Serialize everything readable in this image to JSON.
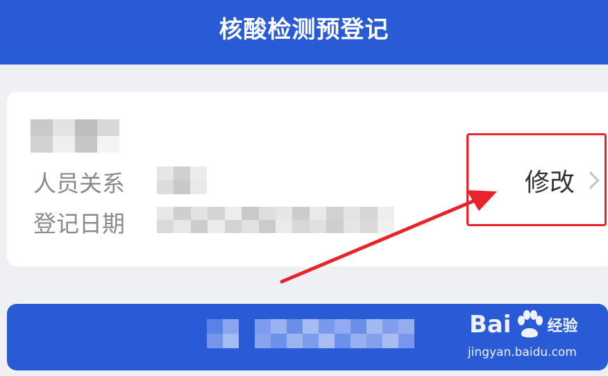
{
  "header": {
    "title": "核酸检测预登记"
  },
  "record": {
    "relation_label": "人员关系",
    "date_label": "登记日期",
    "edit_label": "修改"
  },
  "watermark": {
    "brand_left": "Bai",
    "brand_right": "经验",
    "url": "jingyan.baidu.com"
  },
  "colors": {
    "brand_blue": "#2a5bd7",
    "annotation_red": "#e8232a",
    "background": "#eef0f4"
  },
  "icons": {
    "edit_chevron": "chevron-right-icon",
    "watermark": "baidu-paw-icon"
  }
}
